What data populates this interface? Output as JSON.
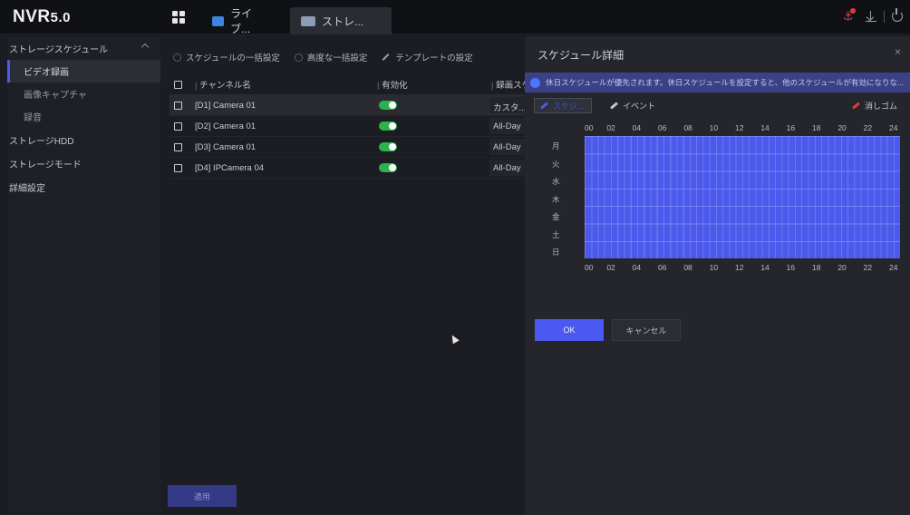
{
  "app": {
    "title": "NVR",
    "version": "5.0"
  },
  "top_tabs": [
    {
      "label": "ライブ..."
    },
    {
      "label": "ストレ..."
    }
  ],
  "sidebar": {
    "items": [
      {
        "label": "ストレージスケジュール"
      },
      {
        "label": "ビデオ録画"
      },
      {
        "label": "画像キャプチャ"
      },
      {
        "label": "録音"
      },
      {
        "label": "ストレージHDD"
      },
      {
        "label": "ストレージモード"
      },
      {
        "label": "詳細設定"
      }
    ]
  },
  "toolbar": {
    "batch": "スケジュールの一括設定",
    "advanced": "高度な一括設定",
    "template": "テンプレートの設定"
  },
  "table": {
    "headers": {
      "name": "チャンネル名",
      "enabled": "有効化",
      "schedule": "録画スケ"
    },
    "rows": [
      {
        "name": "[D1] Camera 01",
        "enabled": true,
        "schedule": "カスタ..."
      },
      {
        "name": "[D2] Camera 01",
        "enabled": true,
        "schedule": "All-Day"
      },
      {
        "name": "[D3] Camera 01",
        "enabled": true,
        "schedule": "All-Day"
      },
      {
        "name": "[D4] IPCamera 04",
        "enabled": true,
        "schedule": "All-Day"
      }
    ]
  },
  "apply_label": "適用",
  "panel": {
    "title": "スケジュール詳細",
    "close": "×",
    "notice": "休日スケジュールが優先されます。休日スケジュールを設定すると、他のスケジュールが有効になりな...",
    "tools": {
      "schedule": "スケジ...",
      "event": "イベント",
      "eraser": "消しゴム"
    },
    "hours": [
      "00",
      "02",
      "04",
      "06",
      "08",
      "10",
      "12",
      "14",
      "16",
      "18",
      "20",
      "22",
      "24"
    ],
    "days": [
      "月",
      "火",
      "水",
      "木",
      "金",
      "土",
      "日"
    ],
    "ok": "OK",
    "cancel": "キャンセル"
  },
  "colors": {
    "accent": "#4b59f0",
    "toggle_on": "#2bb24c",
    "schedule_fill": "#4c59ea",
    "notice_bg": "#3b4187"
  }
}
